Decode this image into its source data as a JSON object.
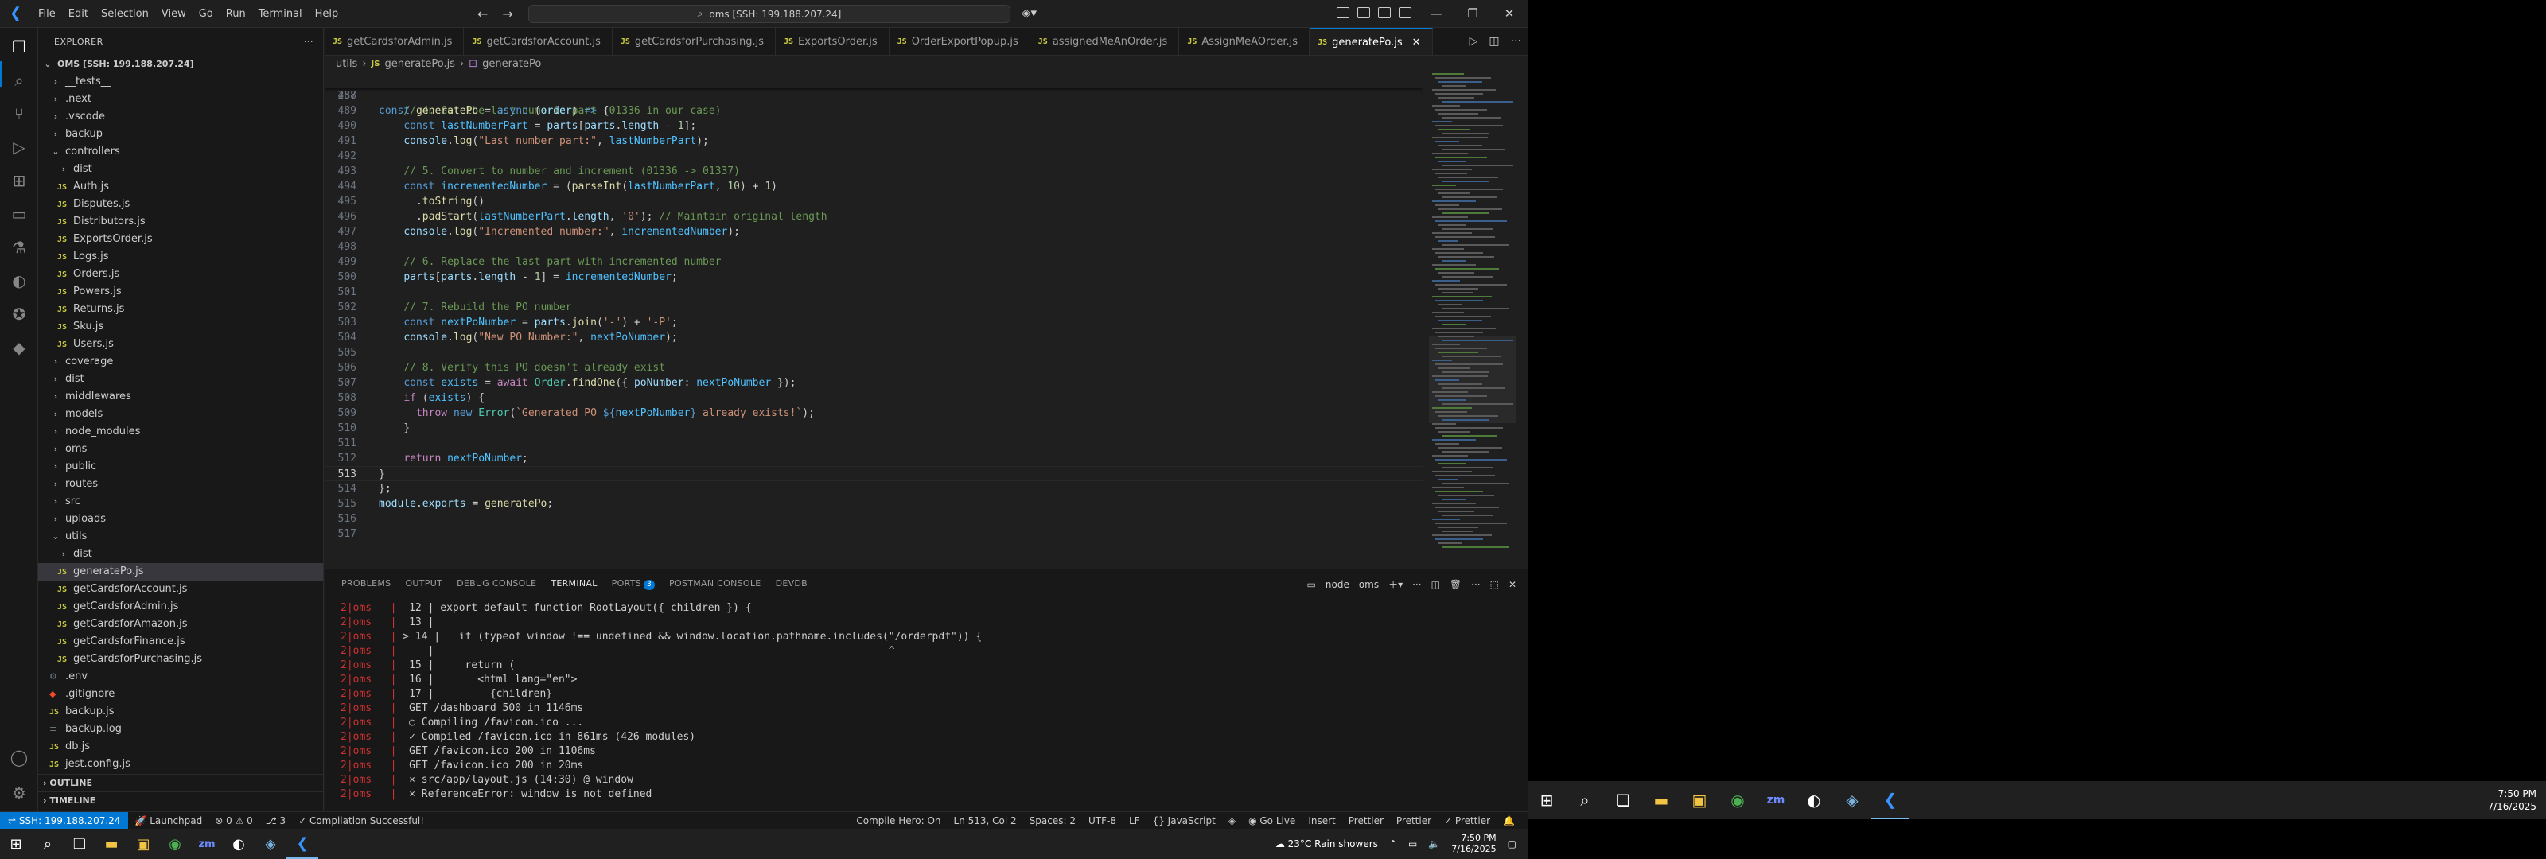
{
  "titlebar": {
    "menu": [
      "File",
      "Edit",
      "Selection",
      "View",
      "Go",
      "Run",
      "Terminal",
      "Help"
    ],
    "search_text": "oms [SSH: 199.188.207.24]",
    "back_arrow": "←",
    "forward_arrow": "→",
    "minimize": "—",
    "restore": "❐",
    "close": "✕"
  },
  "sidebar": {
    "title": "EXPLORER",
    "more": "···",
    "items": [
      {
        "label": "OMS [SSH: 199.188.207.24]",
        "kind": "root",
        "depth": 0
      },
      {
        "label": "__tests__",
        "kind": "folder",
        "depth": 1
      },
      {
        "label": ".next",
        "kind": "folder",
        "depth": 1
      },
      {
        "label": ".vscode",
        "kind": "folder",
        "depth": 1
      },
      {
        "label": "backup",
        "kind": "folder",
        "depth": 1
      },
      {
        "label": "controllers",
        "kind": "folder-open",
        "depth": 1
      },
      {
        "label": "dist",
        "kind": "folder",
        "depth": 2
      },
      {
        "label": "Auth.js",
        "kind": "js",
        "depth": 2
      },
      {
        "label": "Disputes.js",
        "kind": "js",
        "depth": 2
      },
      {
        "label": "Distributors.js",
        "kind": "js",
        "depth": 2
      },
      {
        "label": "ExportsOrder.js",
        "kind": "js",
        "depth": 2
      },
      {
        "label": "Logs.js",
        "kind": "js",
        "depth": 2
      },
      {
        "label": "Orders.js",
        "kind": "js",
        "depth": 2
      },
      {
        "label": "Powers.js",
        "kind": "js",
        "depth": 2
      },
      {
        "label": "Returns.js",
        "kind": "js",
        "depth": 2
      },
      {
        "label": "Sku.js",
        "kind": "js",
        "depth": 2
      },
      {
        "label": "Users.js",
        "kind": "js",
        "depth": 2
      },
      {
        "label": "coverage",
        "kind": "folder",
        "depth": 1
      },
      {
        "label": "dist",
        "kind": "folder",
        "depth": 1
      },
      {
        "label": "middlewares",
        "kind": "folder",
        "depth": 1
      },
      {
        "label": "models",
        "kind": "folder",
        "depth": 1
      },
      {
        "label": "node_modules",
        "kind": "folder",
        "depth": 1
      },
      {
        "label": "oms",
        "kind": "folder",
        "depth": 1
      },
      {
        "label": "public",
        "kind": "folder",
        "depth": 1
      },
      {
        "label": "routes",
        "kind": "folder",
        "depth": 1
      },
      {
        "label": "src",
        "kind": "folder",
        "depth": 1
      },
      {
        "label": "uploads",
        "kind": "folder",
        "depth": 1
      },
      {
        "label": "utils",
        "kind": "folder-open",
        "depth": 1
      },
      {
        "label": "dist",
        "kind": "folder",
        "depth": 2
      },
      {
        "label": "generatePo.js",
        "kind": "js",
        "depth": 2,
        "selected": true
      },
      {
        "label": "getCardsforAccount.js",
        "kind": "js",
        "depth": 2
      },
      {
        "label": "getCardsforAdmin.js",
        "kind": "js",
        "depth": 2
      },
      {
        "label": "getCardsforAmazon.js",
        "kind": "js",
        "depth": 2
      },
      {
        "label": "getCardsforFinance.js",
        "kind": "js",
        "depth": 2
      },
      {
        "label": "getCardsforPurchasing.js",
        "kind": "js",
        "depth": 2
      },
      {
        "label": ".env",
        "kind": "gear",
        "depth": 1
      },
      {
        "label": ".gitignore",
        "kind": "git",
        "depth": 1
      },
      {
        "label": "backup.js",
        "kind": "js",
        "depth": 1
      },
      {
        "label": "backup.log",
        "kind": "log",
        "depth": 1
      },
      {
        "label": "db.js",
        "kind": "js",
        "depth": 1
      },
      {
        "label": "jest.config.js",
        "kind": "js",
        "depth": 1
      }
    ],
    "outline": "OUTLINE",
    "timeline": "TIMELINE"
  },
  "tabs": [
    {
      "label": "getCardsforAdmin.js"
    },
    {
      "label": "getCardsforAccount.js"
    },
    {
      "label": "getCardsforPurchasing.js"
    },
    {
      "label": "ExportsOrder.js"
    },
    {
      "label": "OrderExportPopup.js"
    },
    {
      "label": "assignedMeAnOrder.js"
    },
    {
      "label": "AssignMeAOrder.js"
    },
    {
      "label": "generatePo.js",
      "active": true
    }
  ],
  "tab_close": "✕",
  "breadcrumb": [
    "utils",
    "generatePo.js",
    "generatePo"
  ],
  "code": {
    "sticky_line": {
      "n": "257",
      "text": "const generatePo = async (order) => {"
    },
    "cursor_line": "513"
  },
  "panel": {
    "tabs": [
      "PROBLEMS",
      "OUTPUT",
      "DEBUG CONSOLE",
      "TERMINAL",
      "PORTS",
      "POSTMAN CONSOLE",
      "DEVDB"
    ],
    "active_tab": "TERMINAL",
    "ports_badge": "3",
    "terminal_name": "node - oms",
    "terminal_lines": [
      "2|oms   |  12 | export default function RootLayout({ children }) {",
      "2|oms   |  13 |",
      "2|oms   | > 14 |   if (typeof window !== undefined && window.location.pathname.includes(\"/orderpdf\")) {",
      "2|oms   |     |                                                                         ^",
      "2|oms   |  15 |     return (",
      "2|oms   |  16 |       <html lang=\"en\">",
      "2|oms   |  17 |         {children}",
      "2|oms   |  GET /dashboard 500 in 1146ms",
      "2|oms   |  ○ Compiling /favicon.ico ...",
      "2|oms   |  ✓ Compiled /favicon.ico in 861ms (426 modules)",
      "2|oms   |  GET /favicon.ico 200 in 1106ms",
      "2|oms   |  GET /favicon.ico 200 in 20ms",
      "2|oms   |  ⨯ src/app/layout.js (14:30) @ window",
      "2|oms   |  ⨯ ReferenceError: window is not defined"
    ]
  },
  "statusbar": {
    "remote": "SSH: 199.188.207.24",
    "launchpad": "Launchpad",
    "errors": "0",
    "warnings": "0",
    "info": "3",
    "message": "✓ Compilation Successful!",
    "compile_hero": "Compile Hero: On",
    "position": "Ln 513, Col 2",
    "spaces": "Spaces: 2",
    "encoding": "UTF-8",
    "eol": "LF",
    "language": "JavaScript",
    "golive": "Go Live",
    "insert": "Insert",
    "prettier1": "Prettier",
    "prettier2": "Prettier",
    "prettier3": "✓ Prettier"
  },
  "taskbar": {
    "weather": "23°C  Rain showers",
    "time": "7:50 PM",
    "date": "7/16/2025"
  },
  "taskbar2": {
    "time": "7:50 PM",
    "date": "7/16/2025"
  }
}
